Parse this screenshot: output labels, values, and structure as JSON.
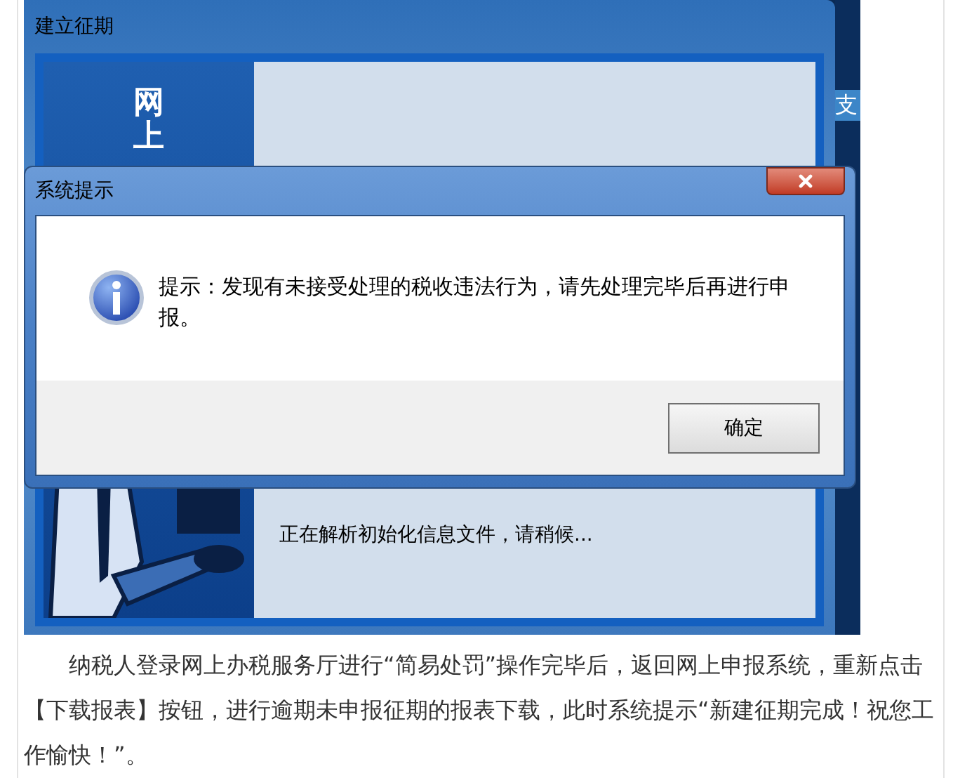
{
  "background_window": {
    "title": "建立征期",
    "side_title": "网上",
    "edge_text": "支",
    "status": "正在解析初始化信息文件，请稍候..."
  },
  "dialog": {
    "title": "系统提示",
    "message": "提示：发现有未接受处理的税收违法行为，请先处理完毕后再进行申报。",
    "buttons": [
      {
        "label": "确定"
      }
    ]
  },
  "article": {
    "paragraph": "纳税人登录网上办税服务厅进行“简易处罚”操作完毕后，返回网上申报系统，重新点击【下载报表】按钮，进行逾期未申报征期的报表下载，此时系统提示“新建征期完成！祝您工作愉快！”。"
  }
}
